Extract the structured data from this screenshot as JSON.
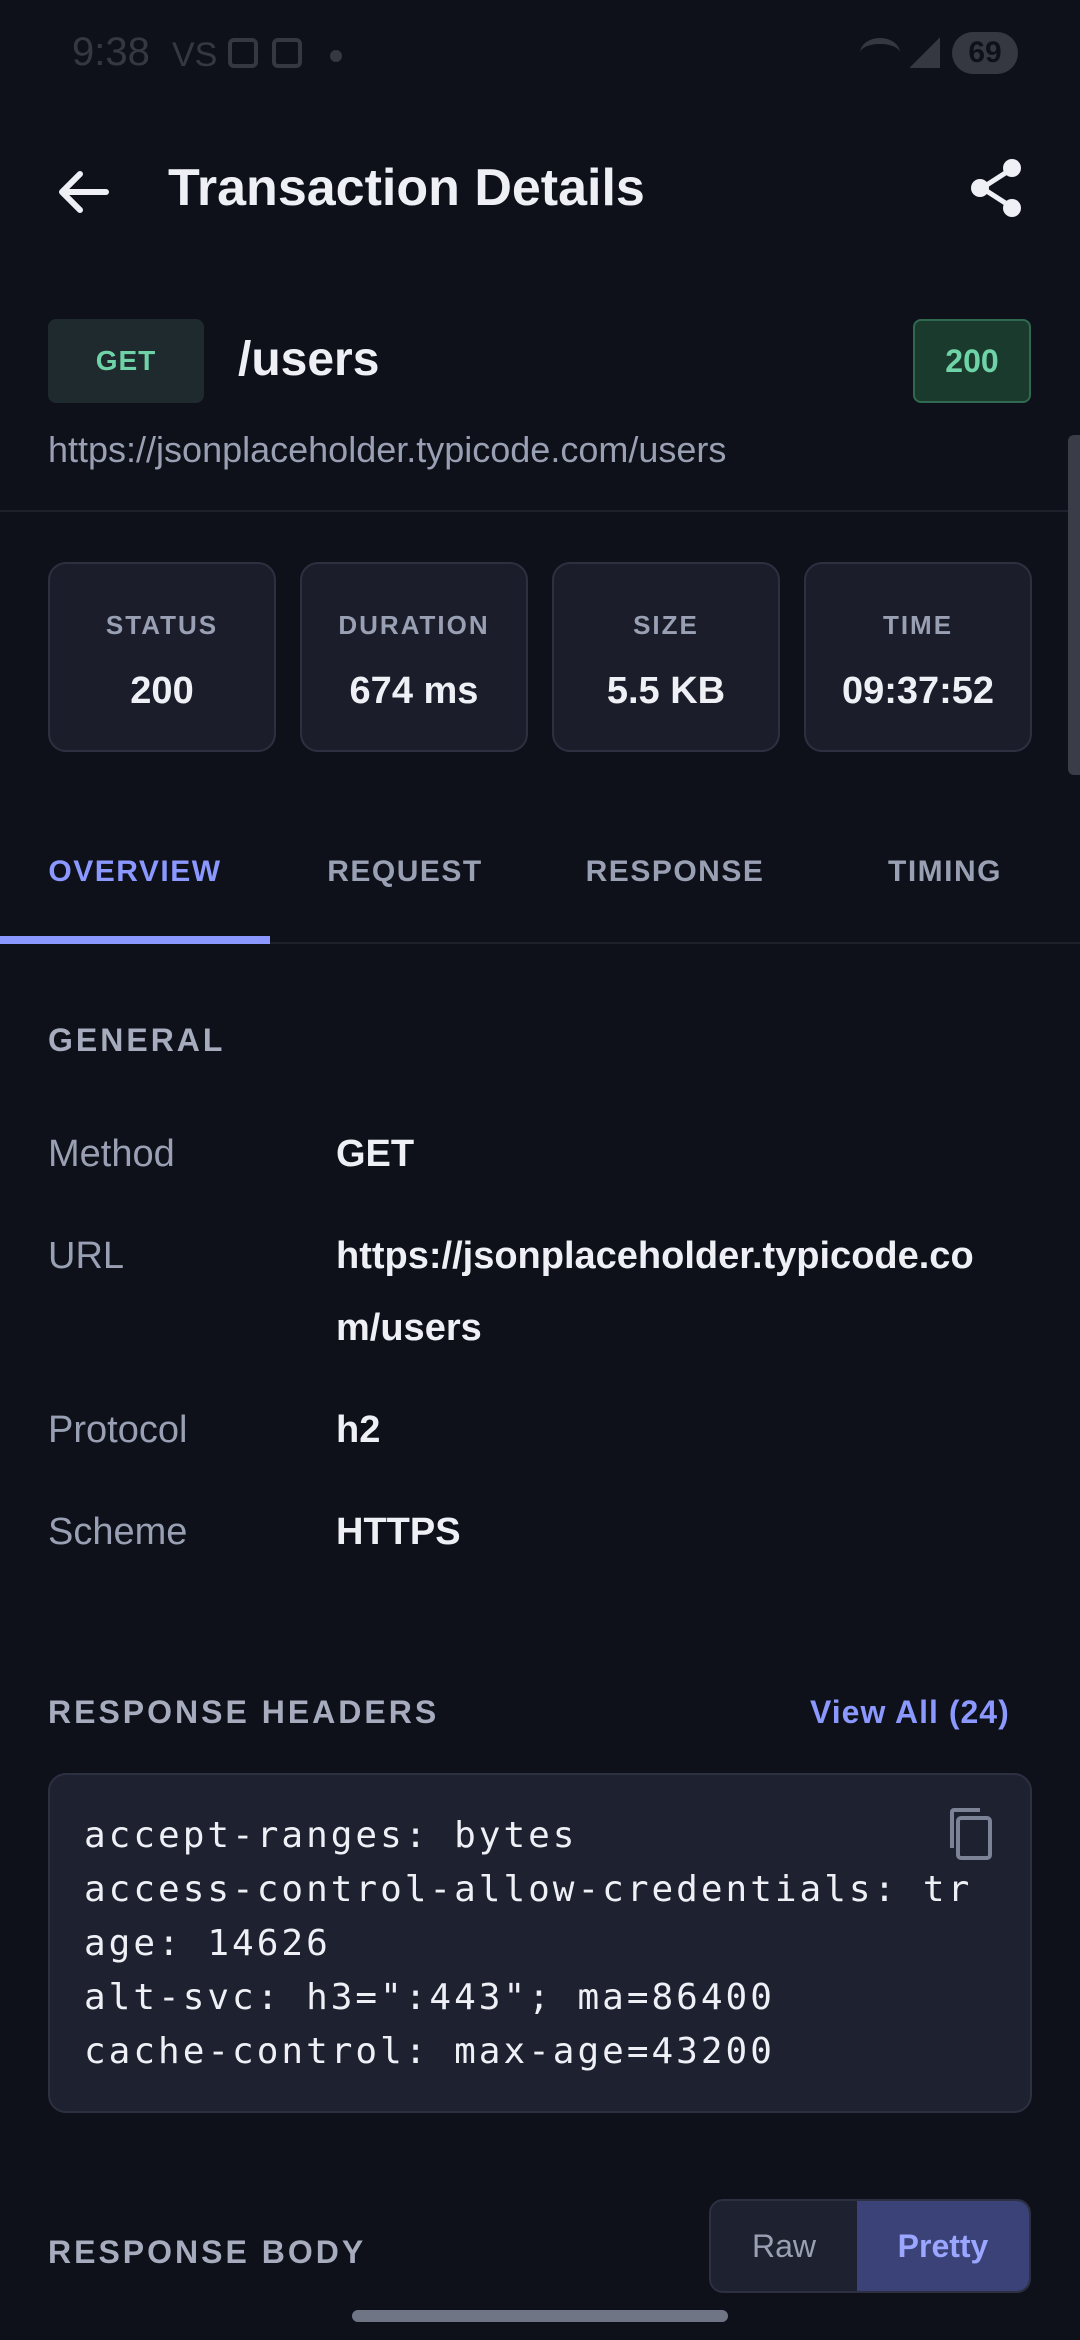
{
  "status_bar": {
    "time": "9:38",
    "carrier": "VS",
    "battery": "69"
  },
  "app_bar": {
    "title": "Transaction Details"
  },
  "endpoint": {
    "method": "GET",
    "path": "/users",
    "status_code": "200",
    "url": "https://jsonplaceholder.typicode.com/users"
  },
  "stats": [
    {
      "label": "STATUS",
      "value": "200"
    },
    {
      "label": "DURATION",
      "value": "674 ms"
    },
    {
      "label": "SIZE",
      "value": "5.5 KB"
    },
    {
      "label": "TIME",
      "value": "09:37:52"
    }
  ],
  "tabs": [
    {
      "label": "OVERVIEW",
      "active": true
    },
    {
      "label": "REQUEST",
      "active": false
    },
    {
      "label": "RESPONSE",
      "active": false
    },
    {
      "label": "TIMING",
      "active": false
    }
  ],
  "general": {
    "heading": "GENERAL",
    "rows": [
      {
        "key": "Method",
        "value": "GET"
      },
      {
        "key": "URL",
        "value": "https://jsonplaceholder.typicode.com/users"
      },
      {
        "key": "Protocol",
        "value": "h2"
      },
      {
        "key": "Scheme",
        "value": "HTTPS"
      }
    ]
  },
  "response_headers": {
    "heading": "RESPONSE HEADERS",
    "view_all": "View All (24)",
    "lines": [
      "accept-ranges: bytes",
      "access-control-allow-credentials: tr",
      "age: 14626",
      "alt-svc: h3=\":443\"; ma=86400",
      "cache-control: max-age=43200"
    ]
  },
  "response_body": {
    "heading": "RESPONSE BODY",
    "toggle": {
      "raw": "Raw",
      "pretty": "Pretty",
      "selected": "Pretty"
    }
  },
  "colors": {
    "background": "#0e1119",
    "accent": "#8b98ff",
    "success": "#6fd3a7"
  }
}
